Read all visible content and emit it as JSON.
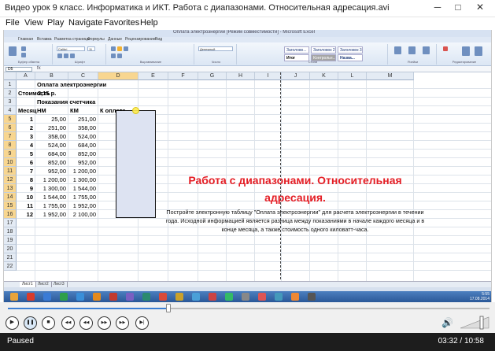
{
  "window": {
    "title": "Видео урок 9 класс. Информатика и ИКТ. Работа с диапазонами. Относительная адресация.avi",
    "minimize": "─",
    "maximize": "□",
    "close": "✕"
  },
  "menu": [
    "File",
    "View",
    "Play",
    "Navigate",
    "Favorites",
    "Help"
  ],
  "excel": {
    "title": "Оплата электроэнергии [Режим совместимости] - Microsoft Excel",
    "tabs": [
      "Главная",
      "Вставка",
      "Разметка страницы",
      "Формулы",
      "Данные",
      "Рецензирование",
      "Вид"
    ],
    "ribbon": {
      "groups": [
        "Буфер обмена",
        "Шрифт",
        "Выравнивание",
        "Число",
        "Стили",
        "Ячейки",
        "Редактирование"
      ],
      "font_name": "Calibri",
      "font_size": "11",
      "number_format": "Денежный",
      "styles": [
        "Заголово...",
        "Заголовок 2",
        "Заголовок 3",
        "Итог",
        "Контрольн...",
        "Назва..."
      ]
    },
    "name_box": "D5",
    "fx": "fx",
    "columns": [
      "A",
      "B",
      "C",
      "D",
      "E",
      "F",
      "G",
      "H",
      "I",
      "J",
      "K",
      "L",
      "M"
    ],
    "rows": [
      [
        "",
        "Оплата электроэнергии",
        "",
        "",
        ""
      ],
      [
        "Стоимость",
        "2,15 р.",
        "",
        "",
        ""
      ],
      [
        "",
        "Показания счетчика",
        "",
        "",
        ""
      ],
      [
        "Месяц",
        "НМ",
        "КМ",
        "К оплате",
        ""
      ],
      [
        "1",
        "25,00",
        "251,00",
        "",
        ""
      ],
      [
        "2",
        "251,00",
        "358,00",
        "",
        ""
      ],
      [
        "3",
        "358,00",
        "524,00",
        "",
        ""
      ],
      [
        "4",
        "524,00",
        "684,00",
        "",
        ""
      ],
      [
        "5",
        "684,00",
        "852,00",
        "",
        ""
      ],
      [
        "6",
        "852,00",
        "952,00",
        "",
        ""
      ],
      [
        "7",
        "952,00",
        "1 200,00",
        "",
        ""
      ],
      [
        "8",
        "1 200,00",
        "1 300,00",
        "",
        ""
      ],
      [
        "9",
        "1 300,00",
        "1 544,00",
        "",
        ""
      ],
      [
        "10",
        "1 544,00",
        "1 755,00",
        "",
        ""
      ],
      [
        "11",
        "1 755,00",
        "1 952,00",
        "",
        ""
      ],
      [
        "12",
        "1 952,00",
        "2 100,00",
        "",
        ""
      ],
      [
        "",
        "",
        "",
        "",
        ""
      ],
      [
        "",
        "",
        "",
        "",
        ""
      ],
      [
        "",
        "",
        "",
        "",
        ""
      ],
      [
        "",
        "",
        "",
        "",
        ""
      ],
      [
        "",
        "",
        "",
        "",
        ""
      ],
      [
        "",
        "",
        "",
        "",
        ""
      ]
    ],
    "sheet_tabs": [
      "Лист1",
      "Лист2",
      "Лист3"
    ]
  },
  "overlay": {
    "title": "Работа с диапазонами. Относительная адресация.",
    "text": "Постройте электронную таблицу \"Оплата электроэнергии\" для расчета электроэнергии в течении года. Исходной информацией является разница между показаниями в начале каждого месяца и в конце месяца, а также стоимость одного киловатт-часа."
  },
  "taskbar": {
    "clock": "5:55\n17.08.2014",
    "icon_colors": [
      "#e9a43a",
      "#d83b2a",
      "#3a7bd5",
      "#2f9f4a",
      "#3a8fd9",
      "#e58a1c",
      "#c23a2e",
      "#7a5fc2",
      "#2b8a6e",
      "#d94a3a",
      "#caa12b",
      "#4aa0d8",
      "#c44",
      "#3b6",
      "#888",
      "#d55",
      "#49b",
      "#e83",
      "#555"
    ]
  },
  "player": {
    "progress": 0.333,
    "buttons": {
      "play": "▶",
      "pause": "❚❚",
      "stop": "■",
      "prev": "◀◀",
      "rew": "◀◀",
      "fwd": "▶▶",
      "next": "▶▶",
      "step": "▶|"
    },
    "volume_icon": "🔊",
    "status": "Paused",
    "time": "03:32 / 10:58",
    "accent": "#3b7fd4"
  }
}
